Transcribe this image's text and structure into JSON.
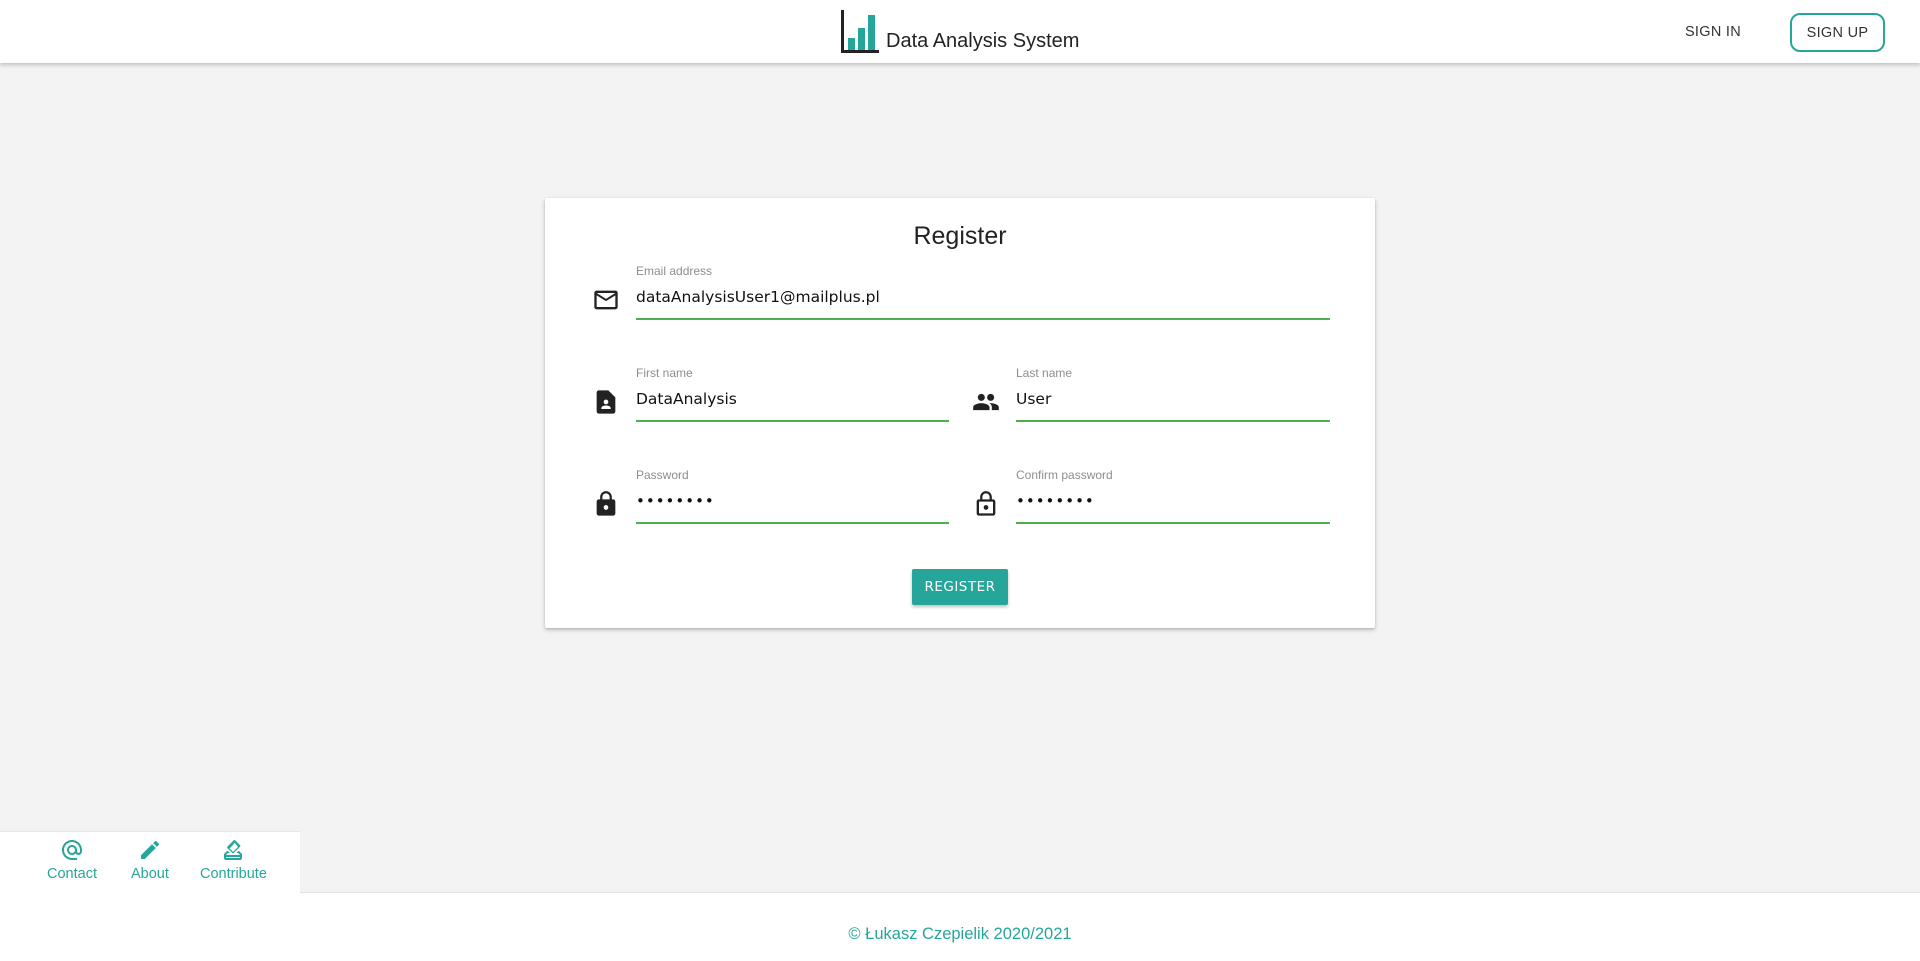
{
  "header": {
    "title": "Data Analysis System",
    "logo_icon": "bar-chart-logo-icon",
    "sign_in_label": "SIGN IN",
    "sign_up_label": "SIGN UP"
  },
  "form": {
    "title": "Register",
    "email": {
      "label": "Email address",
      "value": "dataAnalysisUser1@mailplus.pl",
      "icon": "mail-icon"
    },
    "first_name": {
      "label": "First name",
      "value": "DataAnalysis",
      "icon": "contact-page-icon"
    },
    "last_name": {
      "label": "Last name",
      "value": "User",
      "icon": "people-icon"
    },
    "password": {
      "label": "Password",
      "value": "password",
      "icon": "lock-icon"
    },
    "confirm_password": {
      "label": "Confirm password",
      "value": "password",
      "icon": "lock-open-icon"
    },
    "submit_label": "REGISTER"
  },
  "footer_links": [
    {
      "label": "Contact",
      "icon": "at-sign-icon"
    },
    {
      "label": "About",
      "icon": "pencil-icon"
    },
    {
      "label": "Contribute",
      "icon": "donate-icon"
    }
  ],
  "footer": {
    "copyright": "© Łukasz Czepielik 2020/2021"
  },
  "colors": {
    "accent": "#26a69a",
    "input_underline": "#4caf50",
    "logo_bars": "#26a69a",
    "page_background": "#f3f3f3"
  }
}
